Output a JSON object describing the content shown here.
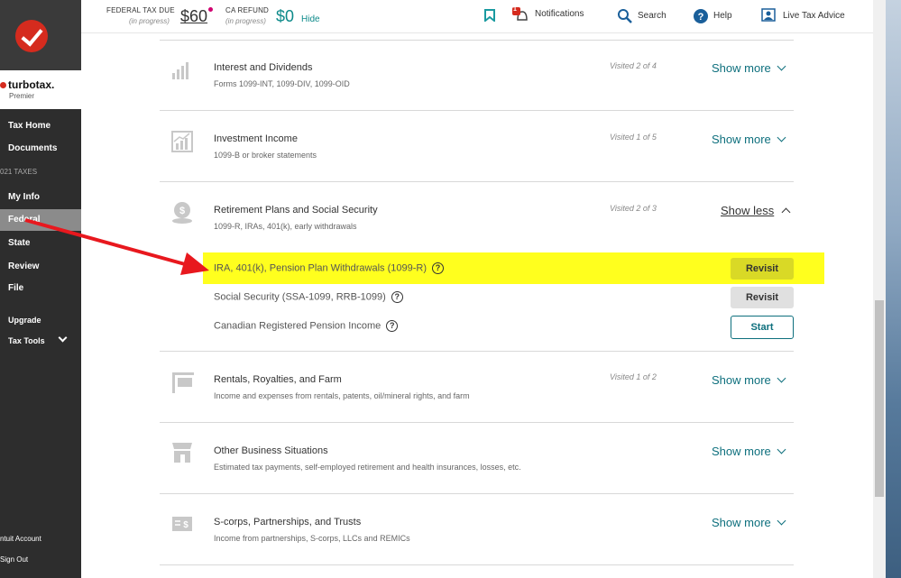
{
  "header": {
    "federal_label": "FEDERAL TAX DUE",
    "federal_sub": "(in progress)",
    "federal_value": "$60",
    "ca_label": "CA REFUND",
    "ca_sub": "(in progress)",
    "ca_value": "$0",
    "hide": "Hide",
    "notifications": "Notifications",
    "notif_count": "1",
    "search": "Search",
    "help": "Help",
    "live": "Live Tax Advice"
  },
  "sidebar": {
    "brand": "turbotax.",
    "edition": "Premier",
    "items": [
      {
        "label": "Tax Home"
      },
      {
        "label": "Documents"
      },
      {
        "label": "My Info"
      },
      {
        "label": "Federal"
      },
      {
        "label": "State"
      },
      {
        "label": "Review"
      },
      {
        "label": "File"
      },
      {
        "label": "Upgrade"
      },
      {
        "label": "Tax Tools"
      },
      {
        "label": "ntuit Account"
      },
      {
        "label": "Sign Out"
      }
    ],
    "section": "021 TAXES"
  },
  "sections": [
    {
      "title": "Interest and Dividends",
      "desc": "Forms 1099-INT, 1099-DIV, 1099-OID",
      "visited": "Visited 2 of 4",
      "toggle": "Show more"
    },
    {
      "title": "Investment Income",
      "desc": "1099-B or broker statements",
      "visited": "Visited 1 of 5",
      "toggle": "Show more"
    },
    {
      "title": "Retirement Plans and Social Security",
      "desc": "1099-R, IRAs, 401(k), early withdrawals",
      "visited": "Visited 2 of 3",
      "toggle": "Show less"
    },
    {
      "title": "Rentals, Royalties, and Farm",
      "desc": "Income and expenses from rentals, patents, oil/mineral rights, and farm",
      "visited": "Visited 1 of 2",
      "toggle": "Show more"
    },
    {
      "title": "Other Business Situations",
      "desc": "Estimated tax payments, self-employed retirement and health insurances, losses, etc.",
      "visited": "",
      "toggle": "Show more"
    },
    {
      "title": "S-corps, Partnerships, and Trusts",
      "desc": "Income from partnerships, S-corps, LLCs and REMICs",
      "visited": "",
      "toggle": "Show more"
    }
  ],
  "subitems": [
    {
      "label": "IRA, 401(k), Pension Plan Withdrawals (1099-R)",
      "button": "Revisit"
    },
    {
      "label": "Social Security (SSA-1099, RRB-1099)",
      "button": "Revisit"
    },
    {
      "label": "Canadian Registered Pension Income",
      "button": "Start"
    }
  ],
  "colors": {
    "accent": "#0d6f7d",
    "brand_red": "#d52b1e",
    "highlight": "#ffff1e",
    "arrow": "#e8181e"
  }
}
